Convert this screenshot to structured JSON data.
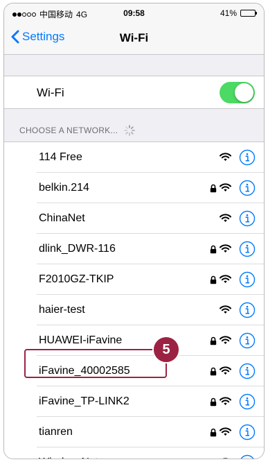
{
  "status_bar": {
    "carrier": "中国移动",
    "network": "4G",
    "time": "09:58",
    "battery": "41%",
    "battery_level": 0.41
  },
  "nav": {
    "back_label": "Settings",
    "title": "Wi-Fi"
  },
  "wifi_toggle": {
    "label": "Wi-Fi",
    "state": "on"
  },
  "section": {
    "header": "CHOOSE A NETWORK..."
  },
  "networks": [
    {
      "name": "114 Free",
      "secured": false
    },
    {
      "name": "belkin.214",
      "secured": true
    },
    {
      "name": "ChinaNet",
      "secured": false
    },
    {
      "name": "dlink_DWR-116",
      "secured": true
    },
    {
      "name": "F2010GZ-TKIP",
      "secured": true
    },
    {
      "name": "haier-test",
      "secured": false
    },
    {
      "name": "HUAWEI-iFavine",
      "secured": true
    },
    {
      "name": "iFavine_40002585",
      "secured": true
    },
    {
      "name": "iFavine_TP-LINK2",
      "secured": true
    },
    {
      "name": "tianren",
      "secured": true
    },
    {
      "name": "WirelessNet",
      "secured": false
    }
  ],
  "callout": {
    "number": "5"
  },
  "colors": {
    "accent": "#007aff",
    "toggle_on": "#4cd964",
    "callout": "#9b2242"
  }
}
